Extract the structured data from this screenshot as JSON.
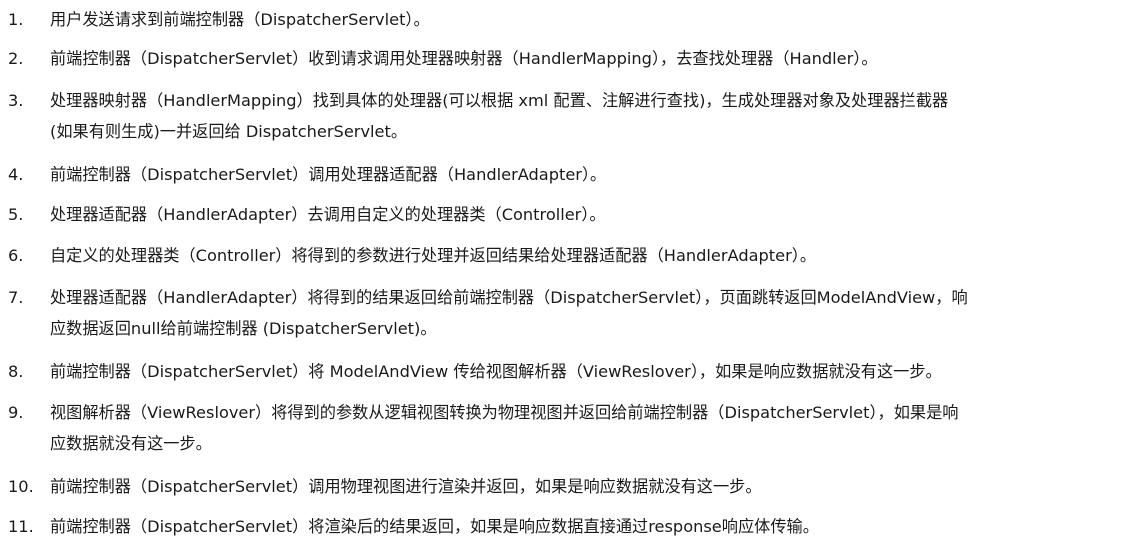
{
  "steps": [
    {
      "num": "1.",
      "lines": [
        "用户发送请求到前端控制器（DispatcherServlet）。"
      ]
    },
    {
      "num": "2.",
      "lines": [
        "前端控制器（DispatcherServlet）收到请求调用处理器映射器（HandlerMapping），去查找处理器（Handler）。"
      ]
    },
    {
      "num": "3.",
      "lines": [
        "处理器映射器（HandlerMapping）找到具体的处理器(可以根据 xml 配置、注解进行查找)，生成处理器对象及处理器拦截器",
        "(如果有则生成)一并返回给 DispatcherServlet。"
      ]
    },
    {
      "num": "4.",
      "lines": [
        "前端控制器（DispatcherServlet）调用处理器适配器（HandlerAdapter）。"
      ]
    },
    {
      "num": "5.",
      "lines": [
        "处理器适配器（HandlerAdapter）去调用自定义的处理器类（Controller）。"
      ]
    },
    {
      "num": "6.",
      "lines": [
        "自定义的处理器类（Controller）将得到的参数进行处理并返回结果给处理器适配器（HandlerAdapter）。"
      ]
    },
    {
      "num": "7.",
      "lines": [
        "处理器适配器（HandlerAdapter）将得到的结果返回给前端控制器（DispatcherServlet），页面跳转返回ModelAndView，响",
        "应数据返回null给前端控制器 (DispatcherServlet)。"
      ]
    },
    {
      "num": "8.",
      "lines": [
        "前端控制器（DispatcherServlet）将 ModelAndView 传给视图解析器（ViewReslover），如果是响应数据就没有这一步。"
      ]
    },
    {
      "num": "9.",
      "lines": [
        "视图解析器（ViewReslover）将得到的参数从逻辑视图转换为物理视图并返回给前端控制器（DispatcherServlet），如果是响",
        "应数据就没有这一步。"
      ]
    },
    {
      "num": "10.",
      "lines": [
        "前端控制器（DispatcherServlet）调用物理视图进行渲染并返回，如果是响应数据就没有这一步。"
      ]
    },
    {
      "num": "11.",
      "lines": [
        "前端控制器（DispatcherServlet）将渲染后的结果返回，如果是响应数据直接通过response响应体传输。"
      ]
    }
  ]
}
